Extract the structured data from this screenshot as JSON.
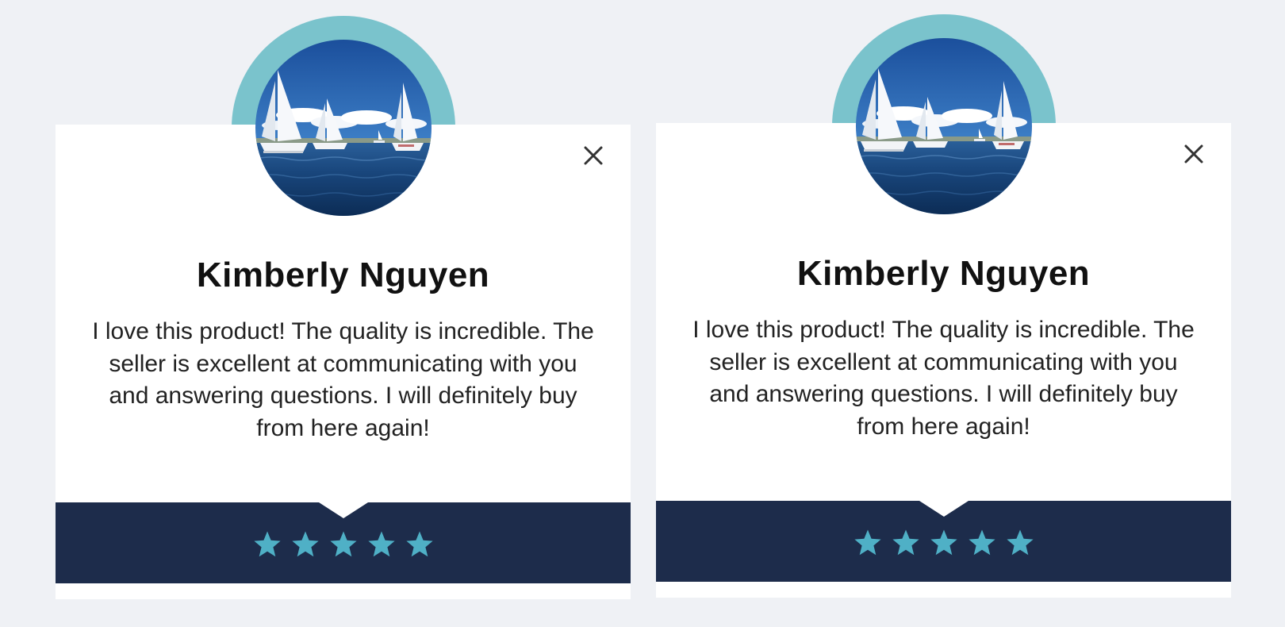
{
  "colors": {
    "background": "#eff1f5",
    "avatar_ring": "#7ac3cc",
    "card": "#ffffff",
    "footer": "#1d2c4b",
    "star": "#4fb0c6",
    "close_icon": "#333333"
  },
  "cards": [
    {
      "name": "Kimberly Nguyen",
      "review": "I love this product! The quality is incredible. The seller is excellent at communicating with you and answering questions. I will definitely buy from here again!",
      "rating": 5,
      "rating_max": 5,
      "avatar_icon": "sailboats-photo",
      "close_icon": "close-icon",
      "star_icon": "star-icon"
    },
    {
      "name": "Kimberly Nguyen",
      "review": "I love this product! The quality is incredible. The seller is excellent at communicating with you and answering questions. I will definitely buy from here again!",
      "rating": 5,
      "rating_max": 5,
      "avatar_icon": "sailboats-photo",
      "close_icon": "close-icon",
      "star_icon": "star-icon"
    }
  ]
}
